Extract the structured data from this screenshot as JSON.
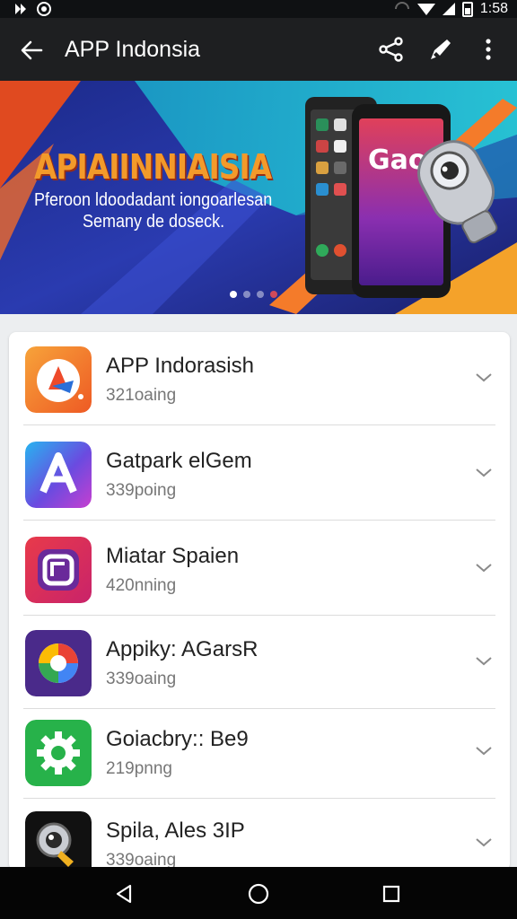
{
  "status_bar": {
    "time": "1:58"
  },
  "app_bar": {
    "title": "APP Indonsia"
  },
  "banner": {
    "headline": "APIAIINNIAISIA",
    "line1": "Pferoon ldoodadant iongoarlesan",
    "line2": "Semany de doseck.",
    "phone_text": "Gao",
    "slide_count": 4,
    "active_slide": 0
  },
  "apps": [
    {
      "name": "APP Indorasish",
      "subtitle": "321oaing",
      "icon": "orange-app-icon"
    },
    {
      "name": "Gatpark elGem",
      "subtitle": "339poing",
      "icon": "letter-a-app-icon"
    },
    {
      "name": "Miatar Spaien",
      "subtitle": "420nning",
      "icon": "chat-app-icon"
    },
    {
      "name": "Appiky: AGarsR",
      "subtitle": "339oaing",
      "icon": "google-style-app-icon"
    },
    {
      "name": "Goiacbry:: Be9",
      "subtitle": "219pnng",
      "icon": "gear-app-icon"
    },
    {
      "name": "Spila, Ales 3IP",
      "subtitle": "339oaing",
      "icon": "camera-app-icon"
    }
  ],
  "colors": {
    "app_bar": "#1e1f21",
    "status_bar": "#0f1113",
    "headline": "#f39a2a",
    "accent_red": "#e03a3a"
  }
}
